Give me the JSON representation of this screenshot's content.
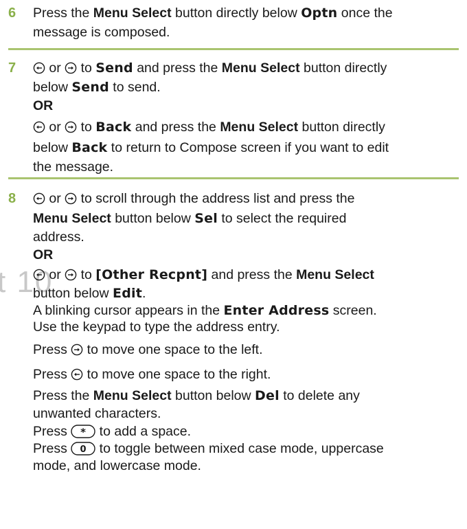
{
  "watermark": "t 10",
  "step6": {
    "number": "6",
    "line1_a": "Press the ",
    "line1_b": "Menu Select",
    "line1_c": " button directly below ",
    "line1_d": "Optn",
    "line1_e": " once the",
    "line2": "message is composed."
  },
  "step7": {
    "number": "7",
    "or": "or",
    "to": " to ",
    "send": "Send",
    "l1_c": " and press the ",
    "menu_select": "Menu Select",
    "l1_e": " button directly",
    "l2_a": "below ",
    "l2_c": " to send.",
    "or_upper": "OR",
    "back": "Back",
    "l4_e": " button directly",
    "l5_a": "below ",
    "l5_c": " to return to Compose screen if you want to edit",
    "l6": "the message."
  },
  "step8": {
    "number": "8",
    "l1_b": " to scroll through the address list and press the",
    "menu_select": "Menu Select",
    "l2_b": " button below ",
    "sel": "Sel",
    "l2_d": " to select the required",
    "l3": "address.",
    "or_upper": "OR",
    "other_recpnt": "[Other Recpnt]",
    "l5_b": " and press the ",
    "l6_a": "button below ",
    "edit": "Edit",
    "l6_c": ".",
    "l7_a": "A blinking cursor appears in the ",
    "enter_address": "Enter Address",
    "l7_c": " screen.",
    "l8": "Use the keypad to type the address entry.",
    "press": "Press ",
    "l9_b": " to move one space to the left.",
    "l10_b": " to move one space to the right.",
    "l11_a": "Press the ",
    "l11_c": " button below ",
    "del": "Del",
    "l11_e": " to delete any",
    "l12": "unwanted characters.",
    "l13_b": " to add a space.",
    "star_key": "*",
    "zero_key": "0",
    "l14_b": " to toggle between mixed case mode, uppercase",
    "l15": "mode, and lowercase mode."
  }
}
